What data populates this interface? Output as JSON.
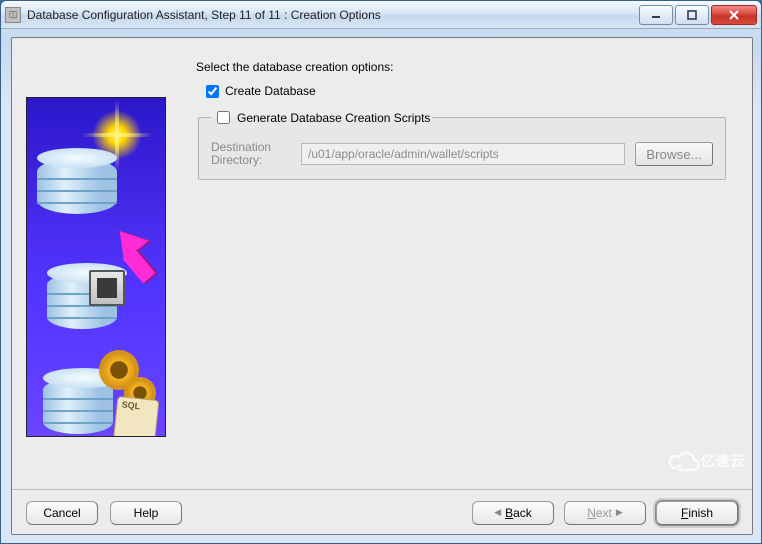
{
  "window": {
    "title": "Database Configuration Assistant, Step 11 of 11 : Creation Options"
  },
  "main": {
    "heading": "Select the database creation options:",
    "create_db": {
      "label": "Create Database",
      "checked": true
    },
    "scripts_group": {
      "legend": "Generate Database Creation Scripts",
      "checked": false,
      "destination_label": "Destination Directory:",
      "destination_value": "/u01/app/oracle/admin/wallet/scripts",
      "browse_label": "Browse...",
      "enabled": false
    }
  },
  "buttons": {
    "cancel": "Cancel",
    "help": "Help",
    "back_full": "Back",
    "next_full": "Next",
    "finish_full": "Finish"
  },
  "watermark": "亿速云"
}
